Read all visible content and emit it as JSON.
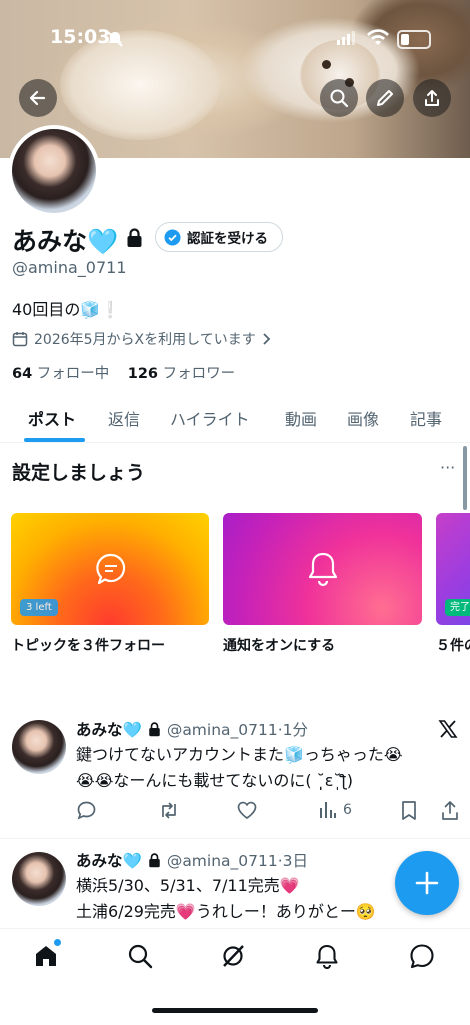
{
  "status_bar": {
    "time": "15:03"
  },
  "profile": {
    "name": "あみな🩵",
    "verify_label": "認証を受ける",
    "handle": "@amina_0711",
    "bio": "40回目の🧊❕",
    "joined": "2026年5月からXを利用しています",
    "following_count": "64",
    "following_label": "フォロー中",
    "followers_count": "126",
    "followers_label": "フォロワー"
  },
  "tabs": [
    "ポスト",
    "返信",
    "ハイライト",
    "動画",
    "画像",
    "記事"
  ],
  "setup": {
    "title": "設定しましょう",
    "more": "···",
    "cards": [
      {
        "label": "トピックを３件フォロー",
        "badge": "3 left"
      },
      {
        "label": "通知をオンにする",
        "badge": ""
      },
      {
        "label": "５件の",
        "badge": "完了"
      }
    ]
  },
  "tweets": [
    {
      "name": "あみな🩵",
      "meta": "@amina_0711·1分",
      "lines": [
        "鍵つけてないアカウントまた🧊っちゃった😭",
        "😭😭なーんにも載せてないのに( ˘̩̩̩ε˘̩ƪ)"
      ],
      "views": "6"
    },
    {
      "name": "あみな🩵",
      "meta": "@amina_0711·3日",
      "lines": [
        "横浜5/30、5/31、7/11完売💗",
        "土浦6/29完売💗うれしー！ありがとー🥺"
      ]
    }
  ],
  "colors": {
    "accent": "#1d9bf0",
    "text": "#0f1419",
    "secondary": "#536471"
  },
  "icons": [
    "back-arrow-icon",
    "search-icon",
    "edit-icon",
    "share-icon",
    "lock-icon",
    "verified-icon",
    "calendar-icon",
    "chevron-right-icon",
    "x-logo-icon",
    "reply-icon",
    "retweet-icon",
    "like-icon",
    "views-icon",
    "bookmark-icon",
    "plus-icon",
    "home-icon",
    "grok-icon",
    "bell-icon",
    "messages-icon"
  ]
}
